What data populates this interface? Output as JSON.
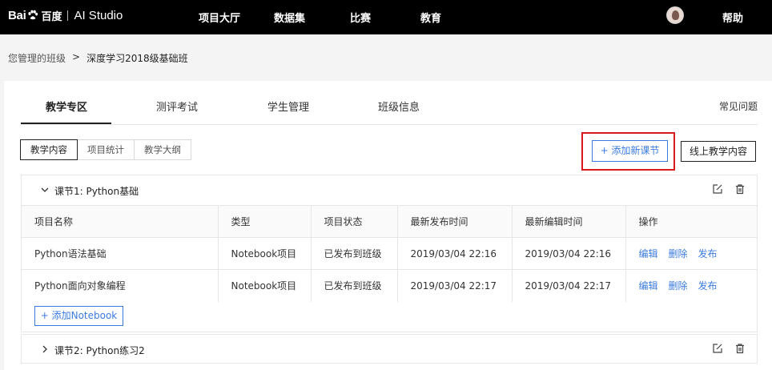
{
  "header": {
    "logo_text": "Bai",
    "logo_cn": "百度",
    "app_name": "AI Studio",
    "nav": [
      "项目大厅",
      "数据集",
      "比赛",
      "教育"
    ],
    "help_label": "帮助"
  },
  "breadcrumb": {
    "parent": "您管理的班级",
    "separator": ">",
    "current": "深度学习2018级基础班"
  },
  "tabs": [
    "教学专区",
    "测评考试",
    "学生管理",
    "班级信息"
  ],
  "faq_label": "常见问题",
  "subtabs": [
    "教学内容",
    "项目统计",
    "教学大纲"
  ],
  "actions": {
    "add_section": "+ 添加新课节",
    "online_content": "线上教学内容"
  },
  "colors": {
    "accent": "#3b7be0",
    "highlight": "#d91919",
    "topbar": "#000000"
  },
  "sections": [
    {
      "title": "课节1: Python基础",
      "columns": [
        "项目名称",
        "类型",
        "项目状态",
        "最新发布时间",
        "最新编辑时间",
        "操作"
      ],
      "rows": [
        {
          "name": "Python语法基础",
          "type": "Notebook项目",
          "status": "已发布到班级",
          "published": "2019/03/04 22:16",
          "edited": "2019/03/04 22:16"
        },
        {
          "name": "Python面向对象编程",
          "type": "Notebook项目",
          "status": "已发布到班级",
          "published": "2019/03/04 22:17",
          "edited": "2019/03/04 22:17"
        }
      ],
      "ops": [
        "编辑",
        "删除",
        "发布"
      ],
      "add_notebook": "+ 添加Notebook"
    },
    {
      "title": "课节2: Python练习2"
    }
  ]
}
